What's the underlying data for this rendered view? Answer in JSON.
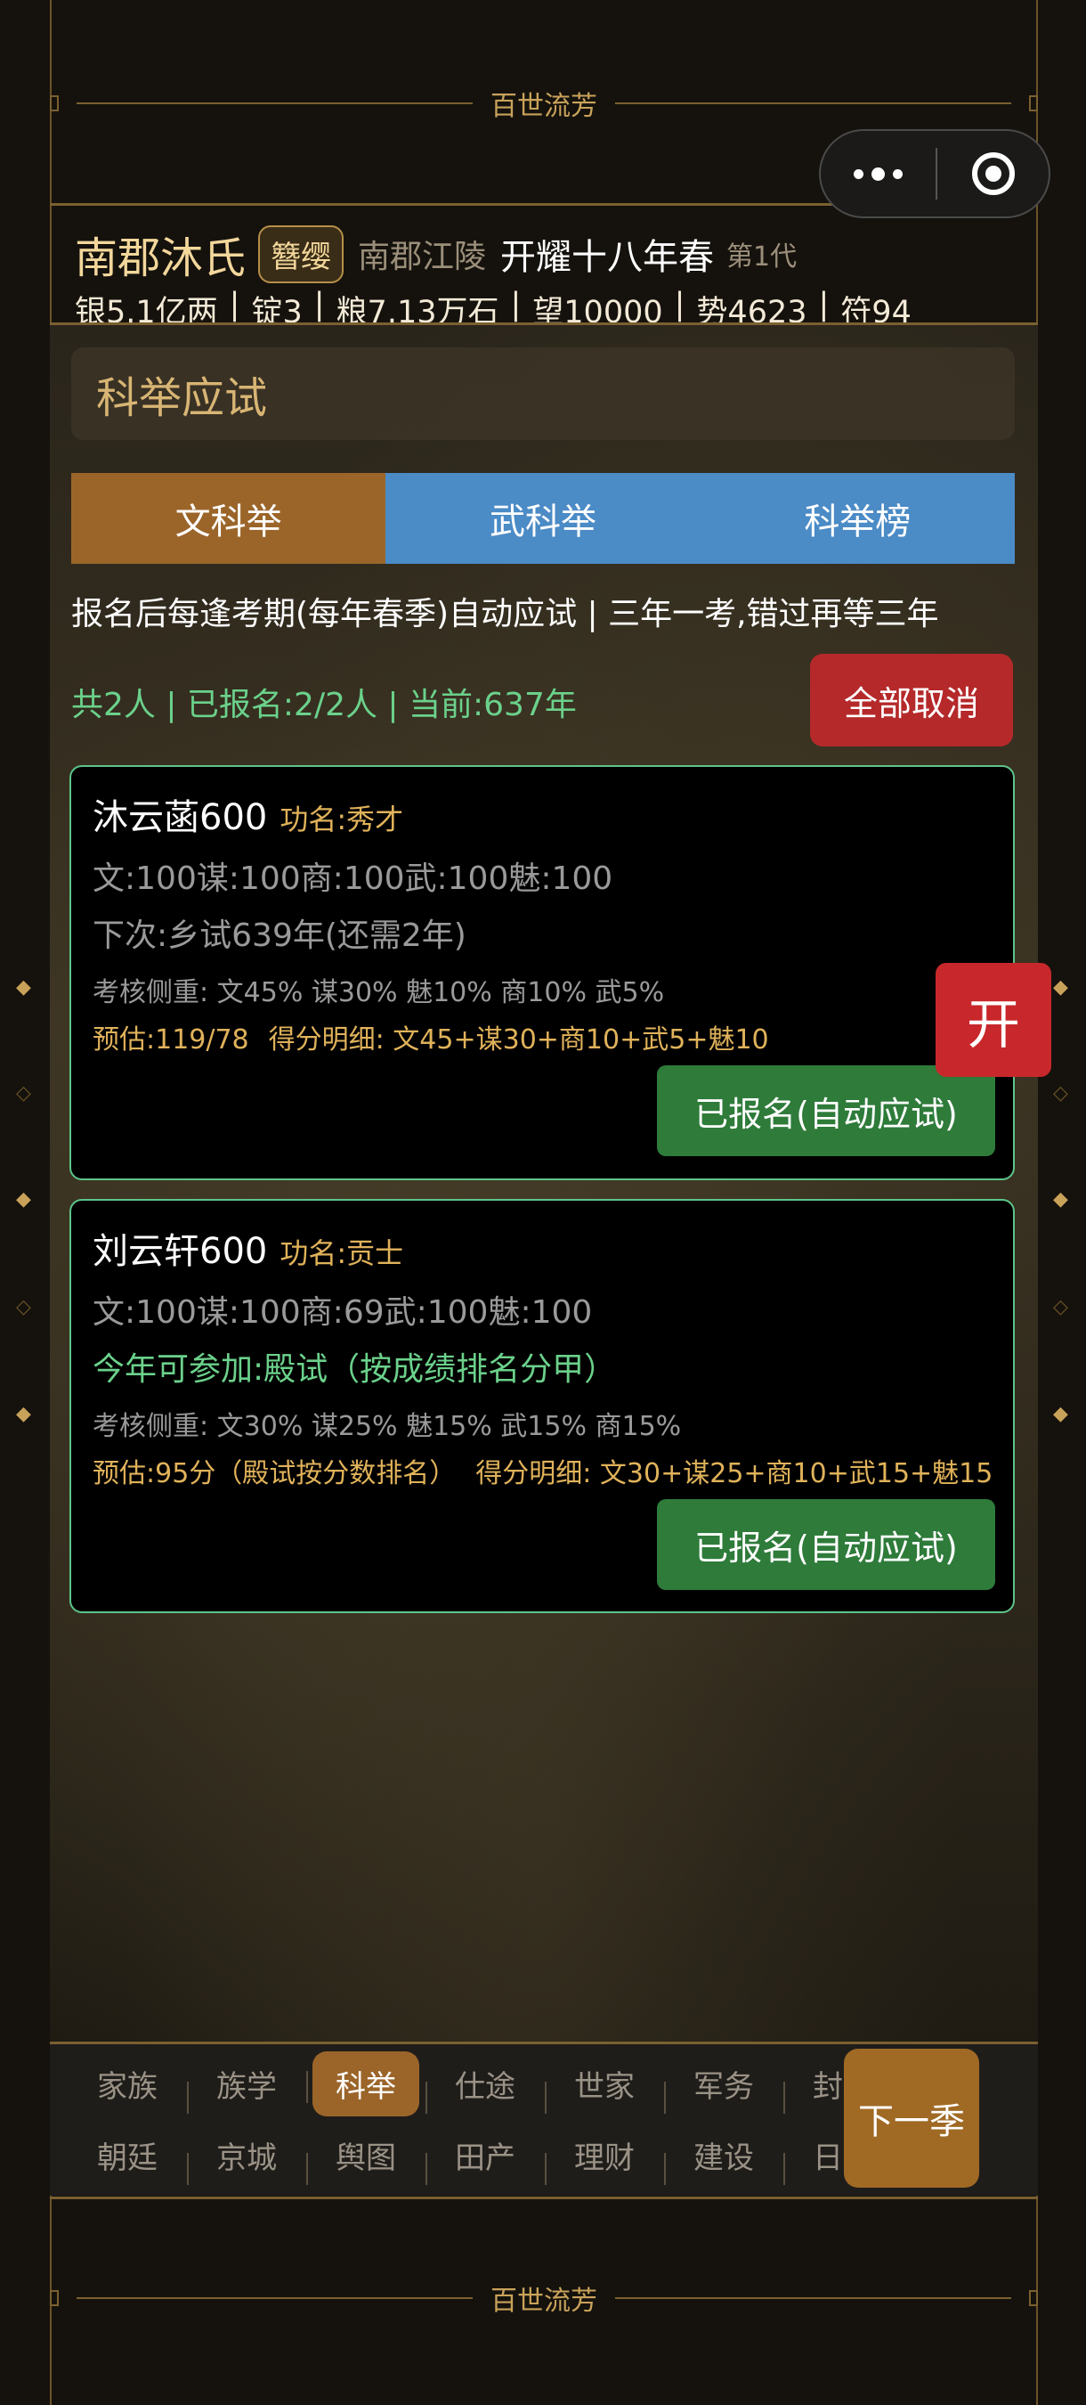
{
  "banner": {
    "title": "百世流芳"
  },
  "capsule": {
    "more_icon": "more-dots-icon",
    "close_icon": "target-circle-icon"
  },
  "family": {
    "name": "南郡沐氏",
    "rank": "簪缨",
    "region": "南郡江陵",
    "era": "开耀十八年春",
    "generation": "第1代"
  },
  "stats": [
    "银5.1亿两",
    "锭3",
    "粮7.13万石",
    "望10000",
    "势4623",
    "符94"
  ],
  "stats_separator": "|",
  "section": {
    "title": "科举应试"
  },
  "tabs": [
    {
      "label": "文科举",
      "active": true
    },
    {
      "label": "武科举",
      "active": false
    },
    {
      "label": "科举榜",
      "active": false
    }
  ],
  "rule_text": "报名后每逢考期(每年春季)自动应试 | 三年一考,错过再等三年",
  "summary": "共2人 | 已报名:2/2人 | 当前:637年",
  "cancel_all_label": "全部取消",
  "candidates": [
    {
      "name": "沐云菡600",
      "title": "功名:秀才",
      "attributes": "文:100谋:100商:100武:100魅:100",
      "next_exam": "下次:乡试639年(还需2年)",
      "weights": "考核侧重: 文45% 谋30% 魅10% 商10% 武5%",
      "estimate": "预估:119/78",
      "breakdown": "得分明细: 文45+谋30+商10+武5+魅10",
      "button": "已报名(自动应试)"
    },
    {
      "name": "刘云轩600",
      "title": "功名:贡士",
      "attributes": "文:100谋:100商:69武:100魅:100",
      "next_exam": "今年可参加:殿试（按成绩排名分甲）",
      "weights": "考核侧重: 文30% 谋25% 魅15% 武15% 商15%",
      "estimate": "预估:95分（殿试按分数排名）",
      "breakdown": "得分明细: 文30+谋25+商10+武15+魅15",
      "button": "已报名(自动应试)"
    }
  ],
  "float_button": "开",
  "nav": {
    "row1": [
      "家族",
      "族学",
      "科举",
      "仕途",
      "世家",
      "军务",
      "封地"
    ],
    "row2": [
      "朝廷",
      "京城",
      "舆图",
      "田产",
      "理财",
      "建设",
      "日志"
    ],
    "active": "科举",
    "next_season": "下一季"
  },
  "colors": {
    "accent_gold": "#c9a25a",
    "tab_active": "#9b652a",
    "tab_inactive": "#4b8bc6",
    "green_text": "#6bd18b",
    "danger": "#b5292a",
    "signed_button": "#2e7b3a"
  }
}
